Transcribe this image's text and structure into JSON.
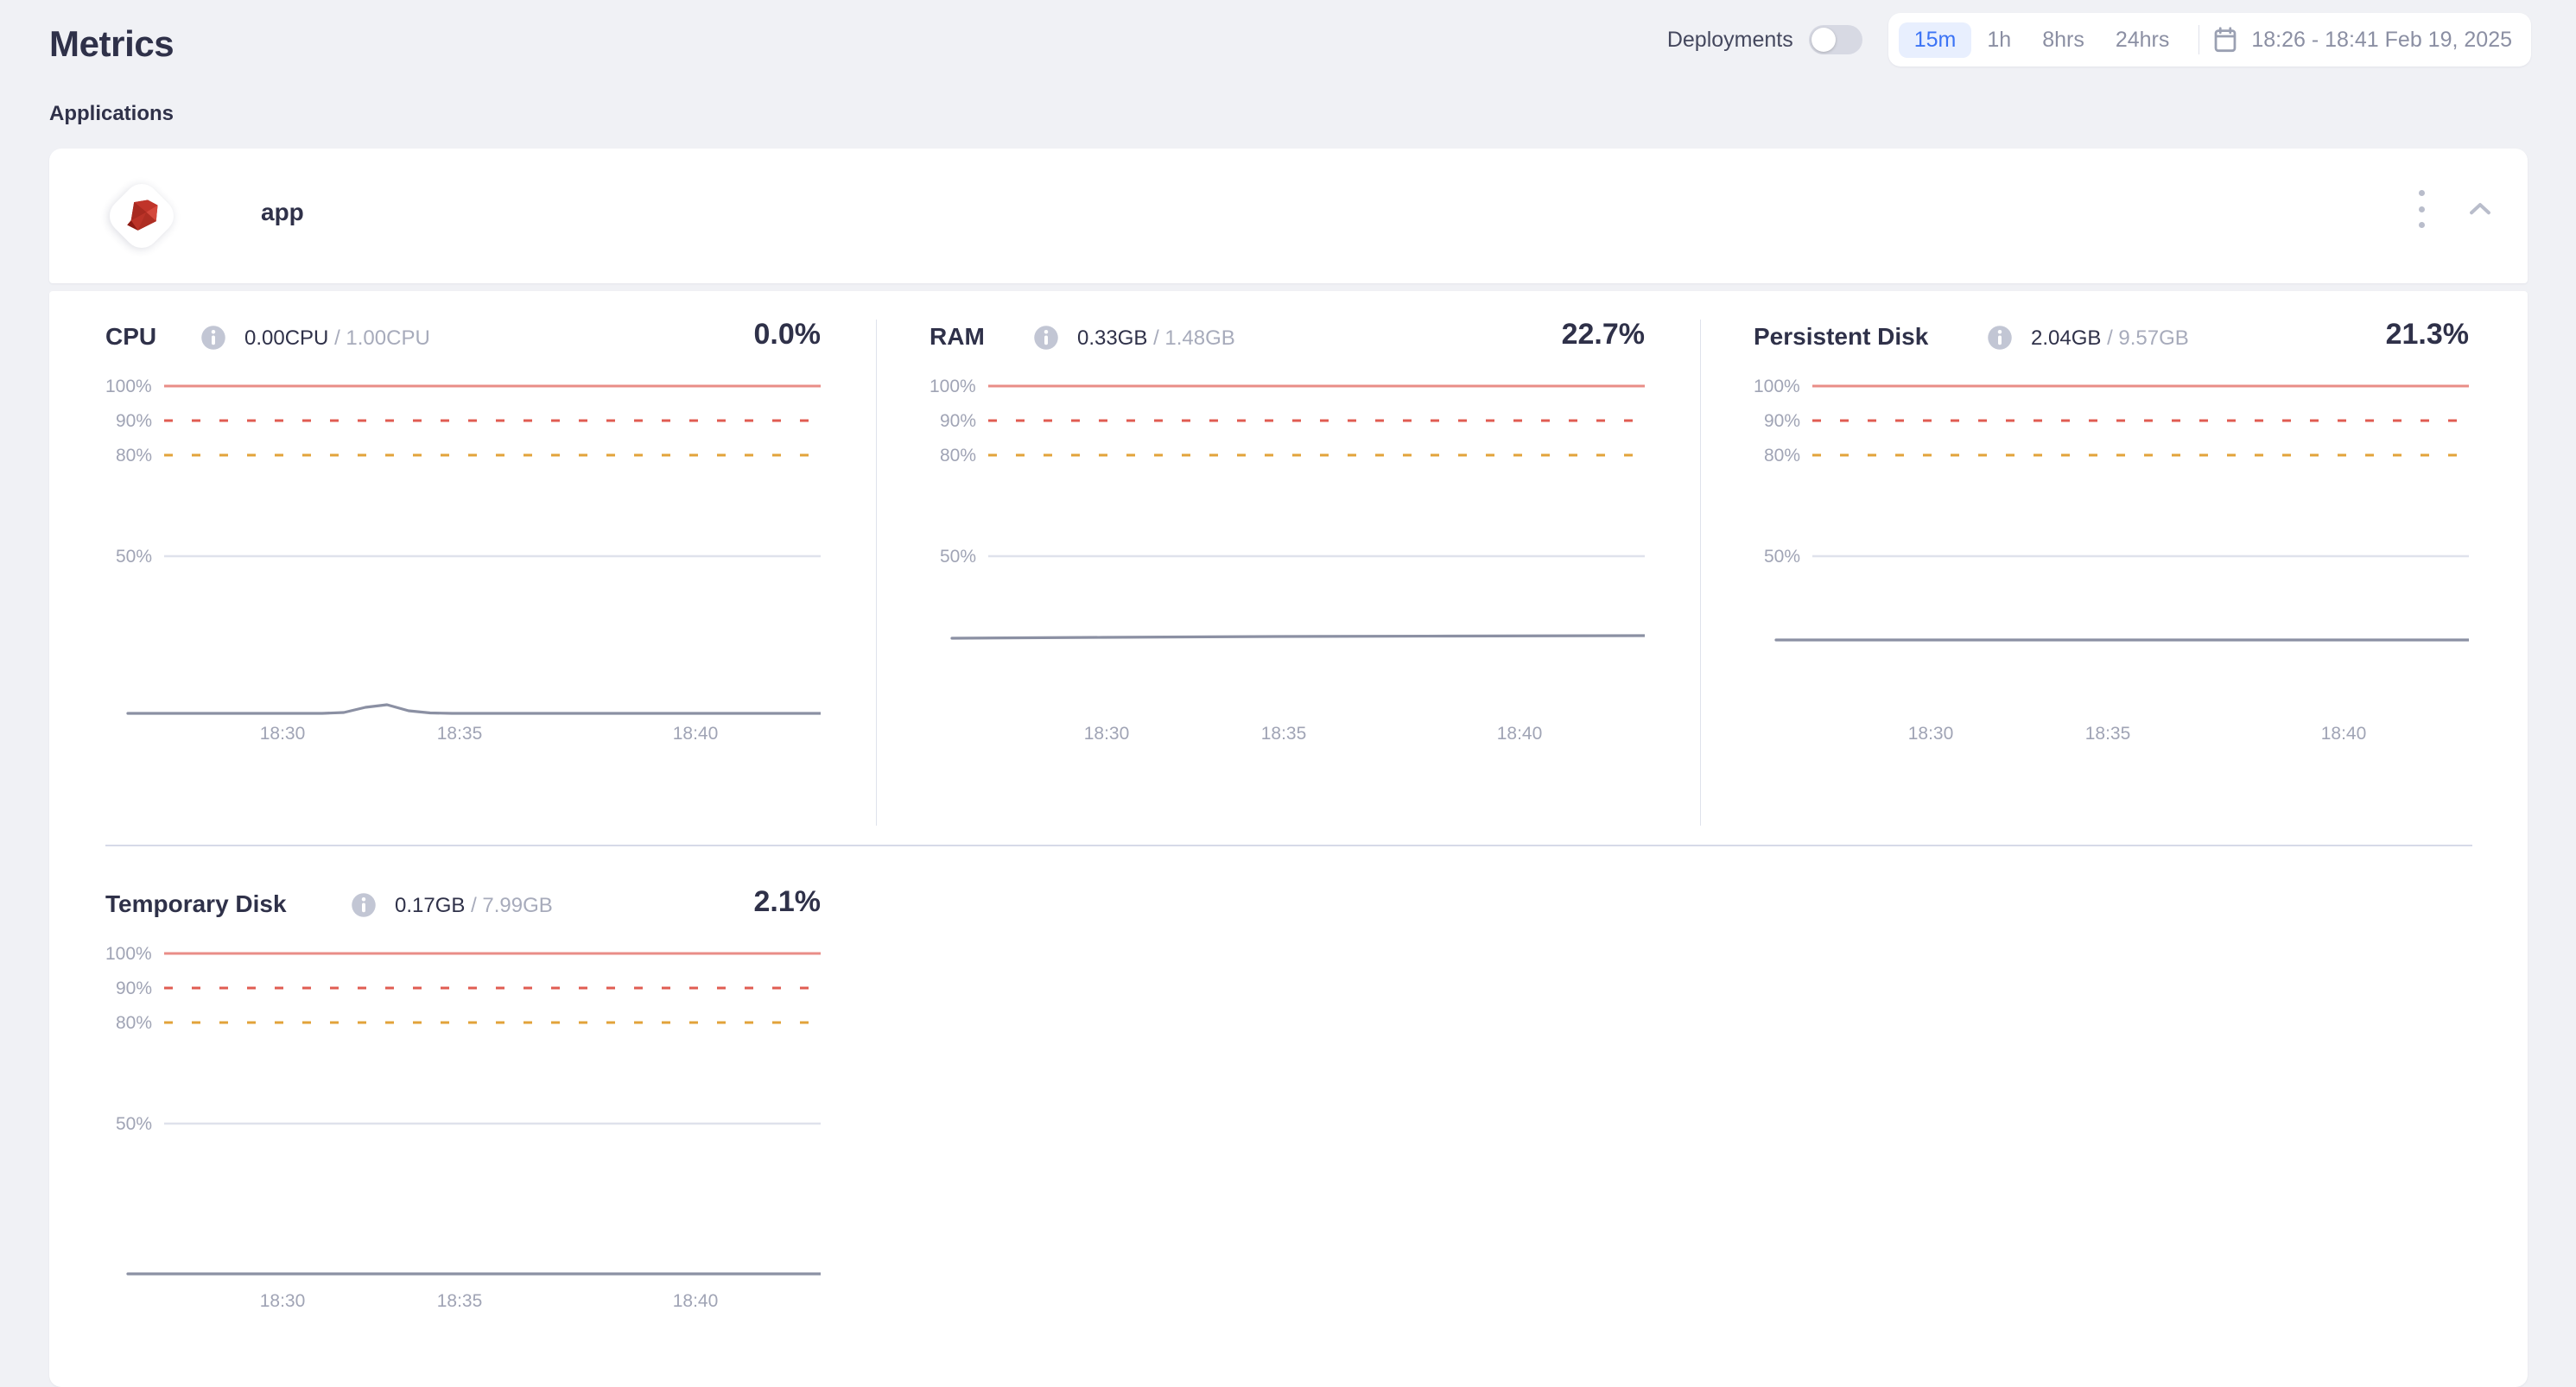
{
  "header": {
    "title": "Metrics",
    "section_label": "Applications",
    "deployments_label": "Deployments",
    "deployments_on": false,
    "ranges": [
      {
        "label": "15m",
        "active": true
      },
      {
        "label": "1h",
        "active": false
      },
      {
        "label": "8hrs",
        "active": false
      },
      {
        "label": "24hrs",
        "active": false
      }
    ],
    "date_range": "18:26 - 18:41 Feb 19, 2025",
    "calendar_icon": "calendar-icon"
  },
  "app": {
    "name": "app",
    "logo_icon": "ruby-logo-icon",
    "menu_icon": "kebab-menu-icon",
    "collapse_icon": "chevron-up-icon"
  },
  "metrics": [
    {
      "id": "cpu",
      "title": "CPU",
      "info_icon": "info-icon",
      "used": "0.00CPU",
      "total": "1.00CPU",
      "separator": "/",
      "percent": "0.0%"
    },
    {
      "id": "ram",
      "title": "RAM",
      "info_icon": "info-icon",
      "used": "0.33GB",
      "total": "1.48GB",
      "separator": "/",
      "percent": "22.7%"
    },
    {
      "id": "persistent-disk",
      "title": "Persistent Disk",
      "info_icon": "info-icon",
      "used": "2.04GB",
      "total": "9.57GB",
      "separator": "/",
      "percent": "21.3%"
    },
    {
      "id": "temporary-disk",
      "title": "Temporary Disk",
      "info_icon": "info-icon",
      "used": "0.17GB",
      "total": "7.99GB",
      "separator": "/",
      "percent": "2.1%"
    }
  ],
  "colors": {
    "accent": "#3b73f5",
    "accent_bg": "#e8effe",
    "page_bg": "#f0f1f5",
    "card_bg": "#ffffff",
    "text": "#2f3149",
    "muted": "#a0a4b5",
    "line_100": "#e98d87",
    "line_90": "#e05c52",
    "line_80": "#e2a33a",
    "line_50": "#dfe2ec",
    "series": "#8b90a3"
  },
  "chart_data": [
    {
      "type": "line",
      "id": "cpu",
      "title": "CPU",
      "ylabel": "",
      "xlabel": "",
      "ylim": [
        0,
        110
      ],
      "ytick_labels": [
        "100%",
        "90%",
        "80%",
        "50%"
      ],
      "ytick_values": [
        100,
        90,
        80,
        50
      ],
      "xtick_labels": [
        "18:30",
        "18:35",
        "18:40"
      ],
      "x": [
        "18:26",
        "18:27",
        "18:28",
        "18:29",
        "18:30",
        "18:31",
        "18:32",
        "18:33",
        "18:34",
        "18:35",
        "18:36",
        "18:37",
        "18:38",
        "18:39",
        "18:40",
        "18:41"
      ],
      "values": [
        0.0,
        0.0,
        0.0,
        0.0,
        0.2,
        1.6,
        2.2,
        0.6,
        0.1,
        0.0,
        0.0,
        0.0,
        0.0,
        0.0,
        0.0,
        0.0
      ],
      "thresholds": [
        {
          "value": 100,
          "style": "solid",
          "color": "#e98d87"
        },
        {
          "value": 90,
          "style": "dashed",
          "color": "#e05c52"
        },
        {
          "value": 80,
          "style": "dashed",
          "color": "#e2a33a"
        },
        {
          "value": 50,
          "style": "solid",
          "color": "#dfe2ec"
        }
      ],
      "grid": false,
      "legend": "none"
    },
    {
      "type": "line",
      "id": "ram",
      "title": "RAM",
      "ylabel": "",
      "xlabel": "",
      "ylim": [
        0,
        110
      ],
      "ytick_labels": [
        "100%",
        "90%",
        "80%",
        "50%"
      ],
      "ytick_values": [
        100,
        90,
        80,
        50
      ],
      "xtick_labels": [
        "18:30",
        "18:35",
        "18:40"
      ],
      "x": [
        "18:26",
        "18:27",
        "18:28",
        "18:29",
        "18:30",
        "18:31",
        "18:32",
        "18:33",
        "18:34",
        "18:35",
        "18:36",
        "18:37",
        "18:38",
        "18:39",
        "18:40",
        "18:41"
      ],
      "values": [
        22.4,
        22.4,
        22.5,
        22.5,
        22.5,
        22.6,
        22.6,
        22.6,
        22.6,
        22.7,
        22.7,
        22.7,
        22.7,
        22.7,
        22.7,
        22.7
      ],
      "thresholds": [
        {
          "value": 100,
          "style": "solid",
          "color": "#e98d87"
        },
        {
          "value": 90,
          "style": "dashed",
          "color": "#e05c52"
        },
        {
          "value": 80,
          "style": "dashed",
          "color": "#e2a33a"
        },
        {
          "value": 50,
          "style": "solid",
          "color": "#dfe2ec"
        }
      ],
      "grid": false,
      "legend": "none"
    },
    {
      "type": "line",
      "id": "persistent-disk",
      "title": "Persistent Disk",
      "ylabel": "",
      "xlabel": "",
      "ylim": [
        0,
        110
      ],
      "ytick_labels": [
        "100%",
        "90%",
        "80%",
        "50%"
      ],
      "ytick_values": [
        100,
        90,
        80,
        50
      ],
      "xtick_labels": [
        "18:30",
        "18:35",
        "18:40"
      ],
      "x": [
        "18:26",
        "18:27",
        "18:28",
        "18:29",
        "18:30",
        "18:31",
        "18:32",
        "18:33",
        "18:34",
        "18:35",
        "18:36",
        "18:37",
        "18:38",
        "18:39",
        "18:40",
        "18:41"
      ],
      "values": [
        21.3,
        21.3,
        21.3,
        21.3,
        21.3,
        21.3,
        21.3,
        21.3,
        21.3,
        21.3,
        21.3,
        21.3,
        21.3,
        21.3,
        21.3,
        21.3
      ],
      "thresholds": [
        {
          "value": 100,
          "style": "solid",
          "color": "#e98d87"
        },
        {
          "value": 90,
          "style": "dashed",
          "color": "#e05c52"
        },
        {
          "value": 80,
          "style": "dashed",
          "color": "#e2a33a"
        },
        {
          "value": 50,
          "style": "solid",
          "color": "#dfe2ec"
        }
      ],
      "grid": false,
      "legend": "none"
    },
    {
      "type": "line",
      "id": "temporary-disk",
      "title": "Temporary Disk",
      "ylabel": "",
      "xlabel": "",
      "ylim": [
        0,
        110
      ],
      "ytick_labels": [
        "100%",
        "90%",
        "80%",
        "50%"
      ],
      "ytick_values": [
        100,
        90,
        80,
        50
      ],
      "xtick_labels": [
        "18:30",
        "18:35",
        "18:40"
      ],
      "x": [
        "18:26",
        "18:27",
        "18:28",
        "18:29",
        "18:30",
        "18:31",
        "18:32",
        "18:33",
        "18:34",
        "18:35",
        "18:36",
        "18:37",
        "18:38",
        "18:39",
        "18:40",
        "18:41"
      ],
      "values": [
        2.1,
        2.1,
        2.1,
        2.1,
        2.1,
        2.1,
        2.1,
        2.1,
        2.1,
        2.1,
        2.1,
        2.1,
        2.1,
        2.1,
        2.1,
        2.1
      ],
      "thresholds": [
        {
          "value": 100,
          "style": "solid",
          "color": "#e98d87"
        },
        {
          "value": 90,
          "style": "dashed",
          "color": "#e05c52"
        },
        {
          "value": 80,
          "style": "dashed",
          "color": "#e2a33a"
        },
        {
          "value": 50,
          "style": "solid",
          "color": "#dfe2ec"
        }
      ],
      "grid": false,
      "legend": "none"
    }
  ]
}
